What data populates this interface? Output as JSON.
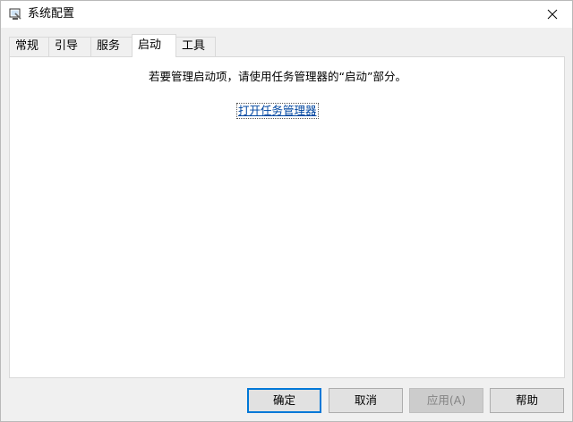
{
  "window": {
    "title": "系统配置"
  },
  "tabs": [
    {
      "label": "常规"
    },
    {
      "label": "引导"
    },
    {
      "label": "服务"
    },
    {
      "label": "启动",
      "active": true
    },
    {
      "label": "工具"
    }
  ],
  "startup": {
    "instruction": "若要管理启动项，请使用任务管理器的“启动”部分。",
    "link_label": "打开任务管理器"
  },
  "buttons": {
    "ok": "确定",
    "cancel": "取消",
    "apply": "应用(A)",
    "help": "帮助"
  },
  "icons": {
    "app": "system-config-icon",
    "close": "close-icon"
  },
  "colors": {
    "link": "#0046a0",
    "default_button_border": "#0078d7"
  }
}
